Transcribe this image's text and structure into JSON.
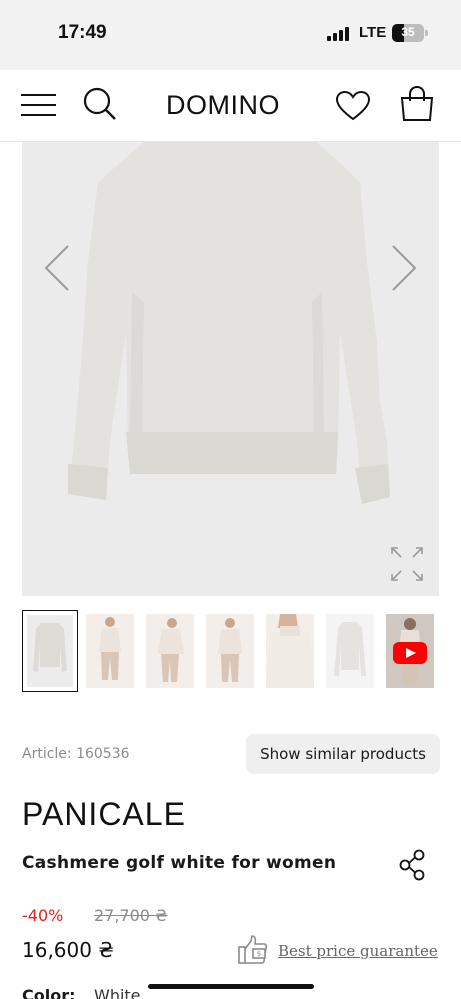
{
  "status_bar": {
    "time": "17:49",
    "network": "LTE",
    "battery": "35"
  },
  "header": {
    "logo": "DOMINO"
  },
  "gallery": {
    "thumbnails": [
      {
        "kind": "image",
        "selected": true
      },
      {
        "kind": "image",
        "selected": false
      },
      {
        "kind": "image",
        "selected": false
      },
      {
        "kind": "image",
        "selected": false
      },
      {
        "kind": "image",
        "selected": false
      },
      {
        "kind": "image",
        "selected": false
      },
      {
        "kind": "video",
        "selected": false
      }
    ]
  },
  "product": {
    "article": "Article: 160536",
    "similar_button": "Show similar products",
    "brand": "PANICALE",
    "name": "Cashmere golf white for women",
    "discount": "-40%",
    "old_price": "27,700 ₴",
    "price": "16,600 ₴",
    "best_price": "Best price guarantee",
    "color_label": "Color:",
    "color_value": "White"
  },
  "colors": {
    "discount": "#e02020",
    "muted": "#8c8c8c"
  },
  "icons": [
    "menu-icon",
    "search-icon",
    "heart-icon",
    "bag-icon",
    "chevron-left-icon",
    "chevron-right-icon",
    "expand-icon",
    "share-icon",
    "thumbs-up-price-icon",
    "youtube-play-icon"
  ]
}
